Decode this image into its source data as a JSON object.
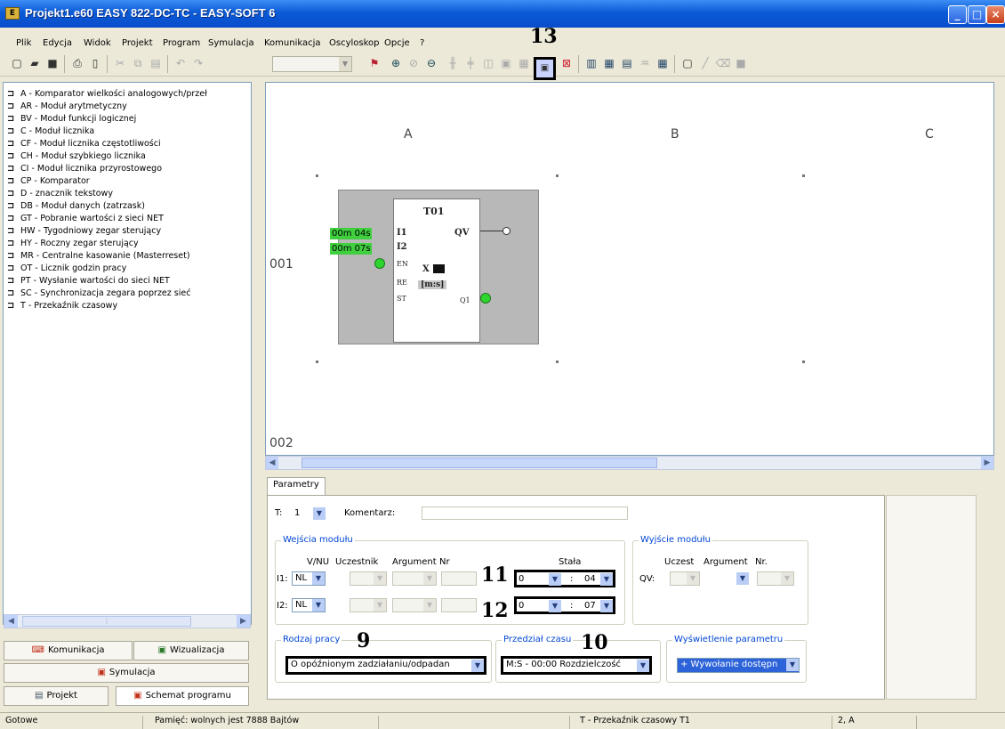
{
  "window": {
    "title": "Projekt1.e60 EASY 822-DC-TC - EASY-SOFT 6",
    "controls": [
      "_",
      "□",
      "×"
    ]
  },
  "menu": [
    "Plik",
    "Edycja",
    "Widok",
    "Projekt",
    "Program",
    "Symulacja",
    "Komunikacja",
    "Oscyloskop",
    "Opcje",
    "?"
  ],
  "callouts": {
    "n9": "9",
    "n10": "10",
    "n11": "11",
    "n12": "12",
    "n13": "13"
  },
  "tree": [
    "A - Komparator wielkości analogowych/przeł",
    "AR - Moduł arytmetyczny",
    "BV - Moduł funkcji logicznej",
    "C - Moduł licznika",
    "CF - Moduł licznika częstotliwości",
    "CH - Moduł szybkiego licznika",
    "CI - Moduł licznika przyrostowego",
    "CP - Komparator",
    "D - znacznik tekstowy",
    "DB - Moduł danych (zatrzask)",
    "GT - Pobranie wartości z sieci NET",
    "HW - Tygodniowy zegar sterujący",
    "HY - Roczny zegar sterujący",
    "MR - Centralne kasowanie (Masterreset)",
    "OT - Licznik godzin pracy",
    "PT - Wysłanie wartości do sieci NET",
    "SC - Synchronizacja zegara poprzez sieć",
    "T - Przekaźnik czasowy"
  ],
  "left_buttons": {
    "komunikacja": "Komunikacja",
    "wizualizacja": "Wizualizacja",
    "symulacja": "Symulacja",
    "projekt": "Projekt",
    "schemat": "Schemat programu"
  },
  "canvas": {
    "columns": [
      "A",
      "B",
      "C"
    ],
    "rows": [
      "001",
      "002"
    ],
    "block": {
      "name": "T01",
      "in1": "I1",
      "in2": "I2",
      "en": "EN",
      "re": "RE",
      "st": "ST",
      "qv": "QV",
      "q1": "Q1",
      "x": "X",
      "unit": "[m:s]",
      "const1": "00m 04s",
      "const2": "00m 07s"
    }
  },
  "params": {
    "tab": "Parametry",
    "t_label": "T:",
    "t_value": "1",
    "comment_label": "Komentarz:",
    "comment_value": "",
    "inputs_group": "Wejścia modułu",
    "outputs_group": "Wyjście modułu",
    "in_headers": {
      "vnu": "V/NU",
      "uczestnik": "Uczestnik",
      "argument": "Argument",
      "nr": "Nr",
      "stala": "Stała"
    },
    "out_headers": {
      "uczest": "Uczest",
      "argument": "Argument",
      "nr": "Nr."
    },
    "i1": {
      "label": "I1:",
      "vnu": "NL",
      "m": "0",
      "colon": ":",
      "s": "04"
    },
    "i2": {
      "label": "I2:",
      "vnu": "NL",
      "m": "0",
      "colon": ":",
      "s": "07"
    },
    "qv_label": "QV:",
    "mode_group": "Rodzaj pracy",
    "mode_value": "O opóźnionym zadziałaniu/odpadan",
    "range_group": "Przedział czasu",
    "range_value": "M:S - 00:00 Rozdzielczość",
    "display_group": "Wyświetlenie parametru",
    "display_value": "+ Wywołanie dostępn"
  },
  "status": {
    "ready": "Gotowe",
    "memory": "Pamięć: wolnych jest 7888 Bajtów",
    "element": "T - Przekaźnik czasowy T1",
    "position": "2, A"
  },
  "colors": {
    "title_bar": "#0a5bd6",
    "constant_green": "#3fcf3f",
    "block_gray": "#b8b8b8",
    "group_label": "#0046d5"
  }
}
